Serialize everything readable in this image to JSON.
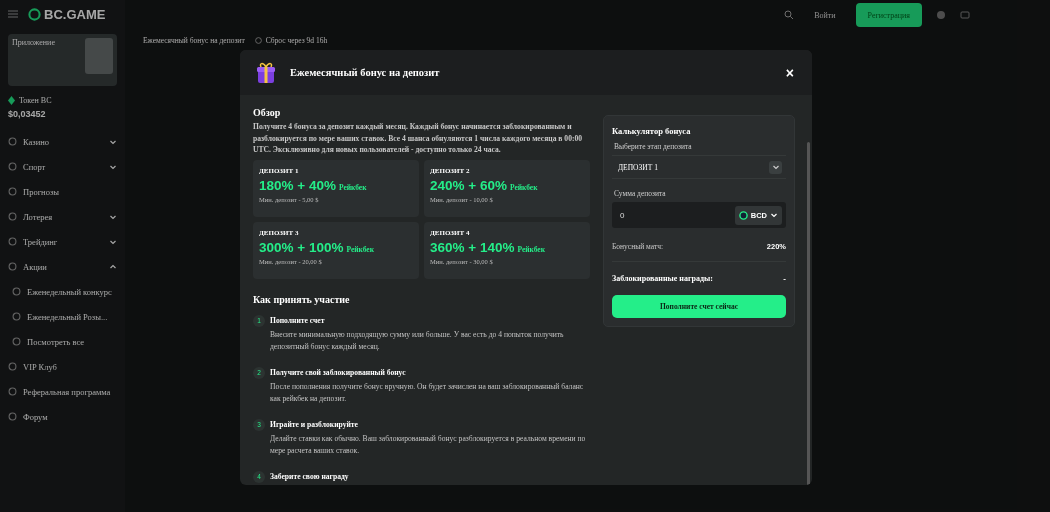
{
  "header": {
    "logo": "BC.GAME",
    "login": "Войти",
    "register": "Регистрация"
  },
  "sidebar": {
    "promo_title": "Приложение",
    "token_label": "Токен BC",
    "token_price": "$0,03452",
    "items": [
      {
        "label": "Казино",
        "expanded": false
      },
      {
        "label": "Спорт",
        "expanded": false
      },
      {
        "label": "Прогнозы"
      },
      {
        "label": "Лотерея",
        "expanded": false
      },
      {
        "label": "Трейдинг",
        "expanded": false
      },
      {
        "label": "Акции",
        "expanded": true,
        "children": [
          {
            "label": "Еженедельный конкурс"
          },
          {
            "label": "Еженедельный Розы..."
          },
          {
            "label": "Посмотреть все"
          }
        ]
      },
      {
        "label": "VIP Клуб"
      },
      {
        "label": "Реферальная программа"
      },
      {
        "label": "Форум"
      }
    ]
  },
  "breadcrumb": {
    "title": "Ежемесячный бонус на депозит",
    "reset": "Сброс через 9d 16h"
  },
  "modal": {
    "title": "Ежемесячный бонус на депозит",
    "close": "×",
    "overview": {
      "heading": "Обзор",
      "text": "Получите 4 бонуса за депозит каждый месяц. Каждый бонус начинается заблокированным и разблокируется по мере ваших ставок. Все 4 шанса обнуляются 1 числа каждого месяца в 00:00 UTC. Эксклюзивно для новых пользователей - доступно только 24 часа."
    },
    "deposits": [
      {
        "label": "ДЕПОЗИТ 1",
        "bonus": "180% + 40%",
        "rakeback": "Рейкбек",
        "min": "Мин. депозит - 5,00 $"
      },
      {
        "label": "ДЕПОЗИТ 2",
        "bonus": "240% + 60%",
        "rakeback": "Рейкбек",
        "min": "Мин. депозит - 10,00 $"
      },
      {
        "label": "ДЕПОЗИТ 3",
        "bonus": "300% + 100%",
        "rakeback": "Рейкбек",
        "min": "Мин. депозит - 20,00 $"
      },
      {
        "label": "ДЕПОЗИТ 4",
        "bonus": "360% + 140%",
        "rakeback": "Рейкбек",
        "min": "Мин. депозит - 30,00 $"
      }
    ],
    "steps_heading": "Как принять участие",
    "steps": [
      {
        "number": "1",
        "title": "Пополните счет",
        "text": "Внесите минимальную подходящую сумму или больше. У вас есть до 4 попыток получить депозитный бонус каждый месяц."
      },
      {
        "number": "2",
        "title": "Получите свой заблокированный бонус",
        "text": "После пополнения получите бонус вручную. Он будет зачислен на ваш заблокированный баланс как рейкбек на депозит."
      },
      {
        "number": "3",
        "title": "Играйте и разблокируйте",
        "text": "Делайте ставки как обычно. Ваш заблокированный бонус разблокируется в реальном времени по мере расчета ваших ставок."
      },
      {
        "number": "4",
        "title": "Заберите свою награду"
      }
    ],
    "calculator": {
      "title": "Калькулятор бонуса",
      "stage_label": "Выберите этап депозита",
      "stage_value": "ДЕПОЗИТ 1",
      "amount_label": "Сумма депозита",
      "amount_value": "0",
      "currency": "BCD",
      "match_label": "Бонусный матч:",
      "match_value": "220%",
      "locked_label": "Заблокированные награды:",
      "locked_value": "-",
      "button": "Пополните счет сейчас"
    }
  }
}
